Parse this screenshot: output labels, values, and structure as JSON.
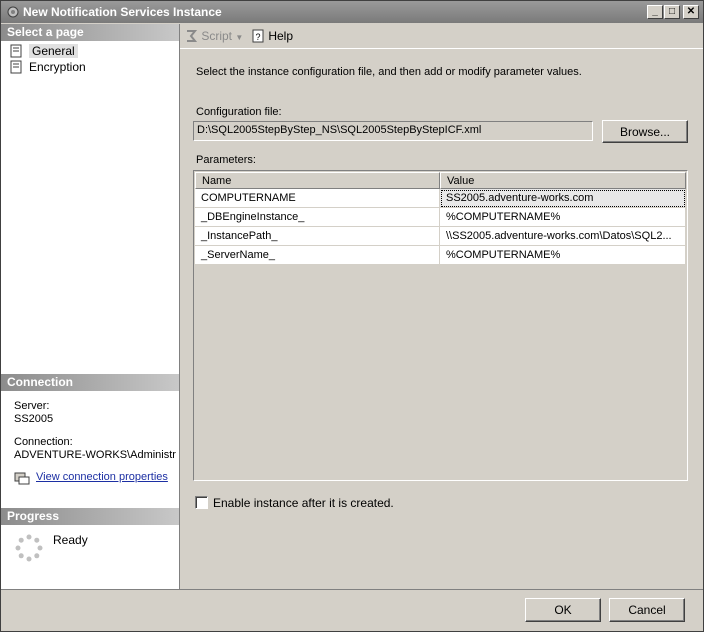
{
  "window": {
    "title": "New Notification Services Instance"
  },
  "left_panel": {
    "select_page_header": "Select a page",
    "pages": [
      {
        "label": "General",
        "icon": "page-icon",
        "selected": true
      },
      {
        "label": "Encryption",
        "icon": "page-icon",
        "selected": false
      }
    ],
    "connection_header": "Connection",
    "server_label": "Server:",
    "server_value": "SS2005",
    "connection_label": "Connection:",
    "connection_value": "ADVENTURE-WORKS\\Administra",
    "view_connection_link": "View connection properties",
    "progress_header": "Progress",
    "progress_status": "Ready"
  },
  "toolbar": {
    "script_label": "Script",
    "help_label": "Help"
  },
  "main": {
    "instruction": "Select the instance configuration file, and then add or modify parameter values.",
    "config_file_label": "Configuration file:",
    "config_file_value": "D:\\SQL2005StepByStep_NS\\SQL2005StepByStepICF.xml",
    "browse_label": "Browse...",
    "parameters_label": "Parameters:",
    "columns": [
      "Name",
      "Value"
    ],
    "rows": [
      {
        "name": "COMPUTERNAME",
        "value": "SS2005.adventure-works.com"
      },
      {
        "name": "_DBEngineInstance_",
        "value": "%COMPUTERNAME%"
      },
      {
        "name": "_InstancePath_",
        "value": "\\\\SS2005.adventure-works.com\\Datos\\SQL2..."
      },
      {
        "name": "_ServerName_",
        "value": "%COMPUTERNAME%"
      }
    ],
    "enable_checkbox_label": "Enable instance after it is created.",
    "enable_checked": false
  },
  "buttons": {
    "ok": "OK",
    "cancel": "Cancel"
  }
}
